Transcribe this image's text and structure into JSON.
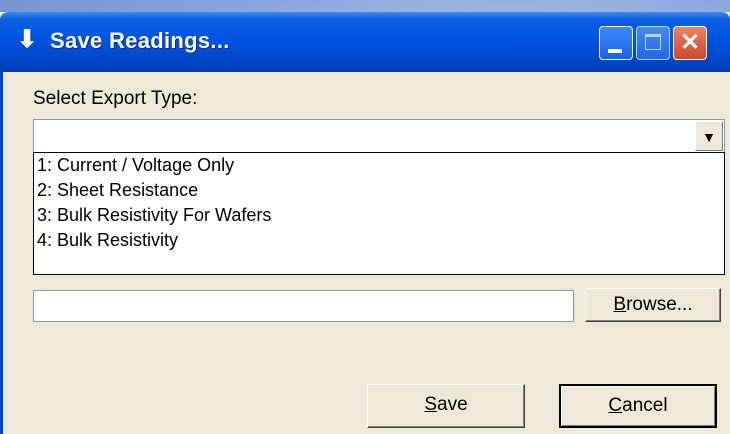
{
  "window": {
    "title": "Save Readings...",
    "app_icon": "down-arrow-icon",
    "controls": [
      "minimize-icon",
      "maximize-icon",
      "close-icon"
    ]
  },
  "form": {
    "export_type_label": "Select Export Type:",
    "export_type_value": "",
    "export_options": [
      "1: Current / Voltage Only",
      "2: Sheet Resistance",
      "3: Bulk Resistivity For Wafers",
      "4: Bulk Resistivity"
    ],
    "file_path_value": "",
    "browse": {
      "access_key": "B",
      "rest": "rowse..."
    },
    "save": {
      "access_key": "S",
      "rest": "ave"
    },
    "cancel": {
      "access_key": "C",
      "rest": "ancel"
    }
  },
  "colors": {
    "titlebar": "#0054e3",
    "dialog_bg": "#ece9d8",
    "close_button": "#d0462a"
  }
}
